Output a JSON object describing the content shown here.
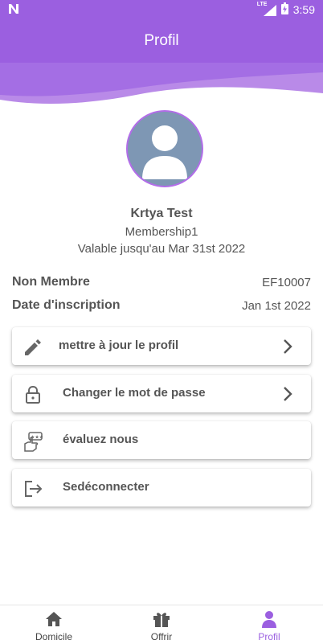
{
  "status_bar": {
    "time": "3:59",
    "network": "LTE"
  },
  "header": {
    "title": "Profil"
  },
  "profile": {
    "name": "Krtya Test",
    "membership": "Membership1",
    "valid_until": "Valable jusqu'au Mar 31st 2022"
  },
  "info": [
    {
      "label": "Non Membre",
      "value": "EF10007"
    },
    {
      "label": "Date d'inscription",
      "value": "Jan 1st 2022"
    }
  ],
  "menu": [
    {
      "label": "mettre à jour le profil",
      "icon": "pencil-icon"
    },
    {
      "label": "Changer le mot de passe",
      "icon": "lock-icon"
    },
    {
      "label": "évaluez nous",
      "icon": "rate-us-icon"
    },
    {
      "label": "Sedéconnecter",
      "icon": "logout-icon"
    }
  ],
  "bottom_nav": {
    "items": [
      {
        "label": "Domicile",
        "icon": "home-icon"
      },
      {
        "label": "Offrir",
        "icon": "gift-icon"
      },
      {
        "label": "Profil",
        "icon": "person-icon"
      }
    ],
    "active": "Profil"
  },
  "colors": {
    "primary": "#9b5fe0",
    "primary_light": "#b98ae8",
    "text": "#555555",
    "avatar_bg": "#7e97b4"
  }
}
